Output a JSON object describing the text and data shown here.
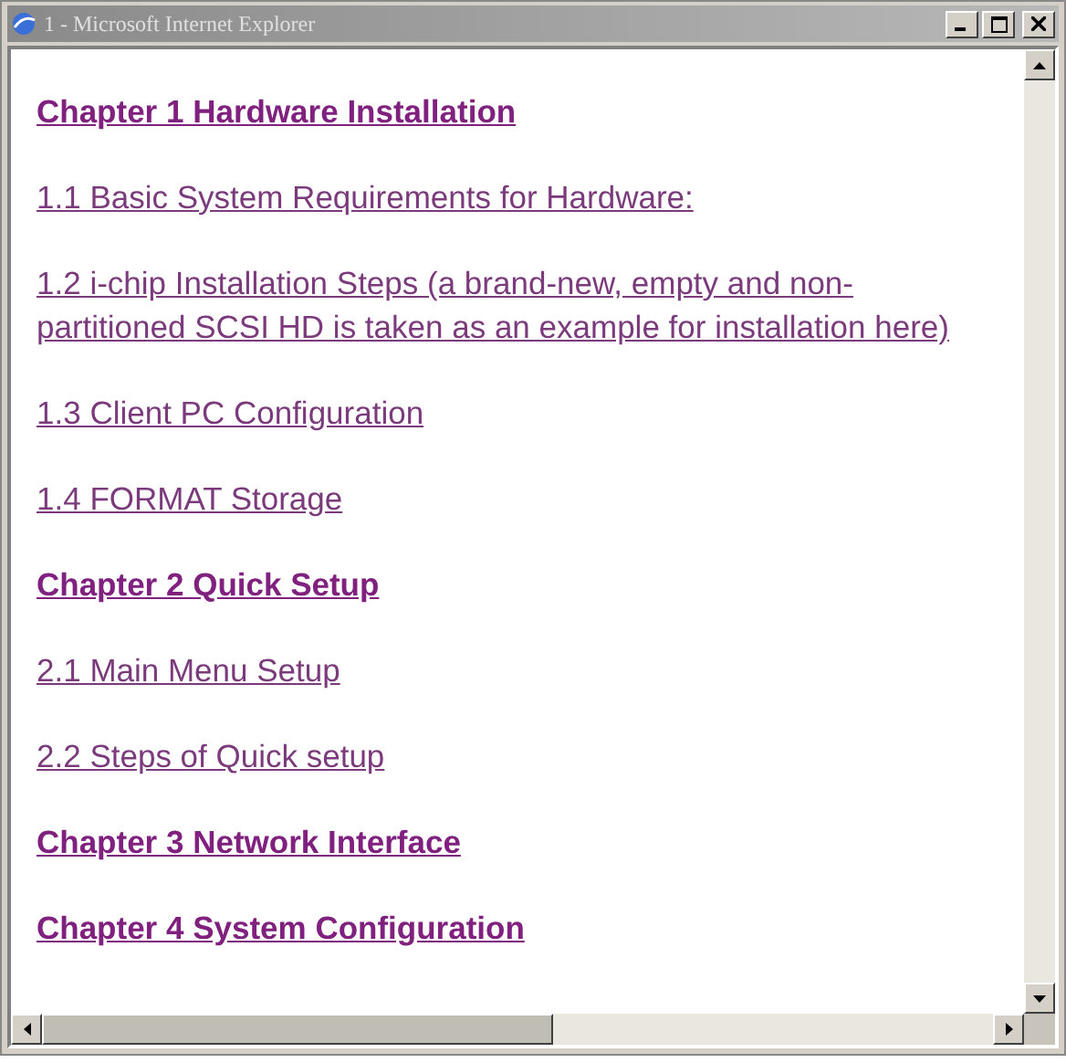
{
  "window": {
    "title": "1 - Microsoft Internet Explorer"
  },
  "links": [
    {
      "kind": "chapter",
      "text": "Chapter 1 Hardware Installation"
    },
    {
      "kind": "section",
      "text": "1.1 Basic System Requirements for Hardware:"
    },
    {
      "kind": "section",
      "text": "1.2 i-chip Installation Steps (a brand-new, empty and non-partitioned SCSI HD is taken as an example for installation here)"
    },
    {
      "kind": "section",
      "text": "1.3 Client PC Configuration"
    },
    {
      "kind": "section",
      "text": "1.4 FORMAT Storage"
    },
    {
      "kind": "chapter",
      "text": "Chapter 2 Quick Setup"
    },
    {
      "kind": "section",
      "text": "2.1 Main Menu Setup"
    },
    {
      "kind": "section",
      "text": "2.2 Steps of Quick setup"
    },
    {
      "kind": "chapter",
      "text": "Chapter 3 Network Interface"
    },
    {
      "kind": "chapter",
      "text": "Chapter 4 System Configuration"
    }
  ]
}
